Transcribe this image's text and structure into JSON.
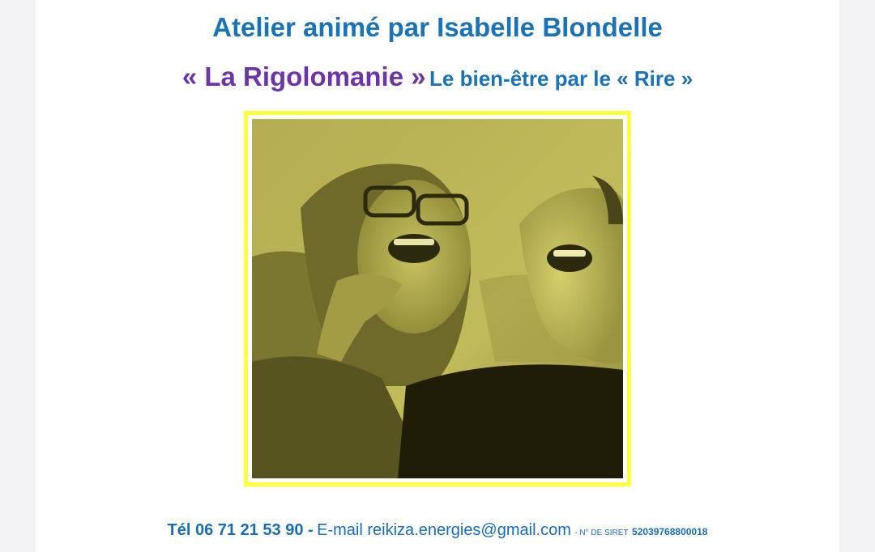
{
  "header": {
    "title": "Atelier animé par Isabelle Blondelle",
    "subtitle_highlight": "« La Rigolomanie »",
    "subtitle_rest": "Le bien-être par le « Rire »"
  },
  "photo": {
    "description_icon": "photo-two-women-laughing",
    "tint_color": "#b8b244",
    "frame_color": "#ffff3a"
  },
  "footer": {
    "phone": "Tél 06 71 21 53 90 -",
    "email": "E-mail reikiza.energies@gmail.com",
    "siret_label": "- N° DE SIRET",
    "siret_number": "52039768800018"
  },
  "colors": {
    "title_blue": "#1a73b8",
    "purple": "#6b35a8",
    "background": "#f3f3f5"
  }
}
